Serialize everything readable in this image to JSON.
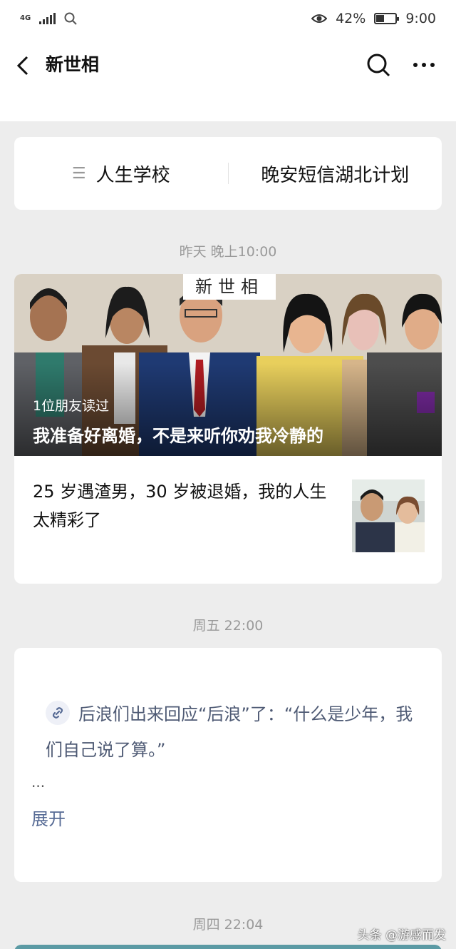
{
  "status_bar": {
    "network": "4G",
    "battery_percent": "42%",
    "battery_level": 0.42,
    "time": "9:00",
    "icons": [
      "signal-icon",
      "search-icon",
      "eye-icon",
      "battery-icon"
    ]
  },
  "nav": {
    "title": "新世相",
    "icons": [
      "back-icon",
      "search-icon",
      "more-icon"
    ]
  },
  "menu": {
    "items": [
      {
        "label": "人生学校",
        "icon": "menu-icon"
      },
      {
        "label": "晚安短信湖北计划"
      }
    ]
  },
  "timestamps": {
    "first": "昨天 晚上10:00",
    "second": "周五 22:00",
    "third": "周四 22:04"
  },
  "article": {
    "brand_tag": "新世相",
    "readers": "1位朋友读过",
    "headline": "我准备好离婚，不是来听你劝我冷静的",
    "sub_title": "25 岁遇渣男，30 岁被退婚，我的人生太精彩了"
  },
  "text_message": {
    "text": "后浪们出来回应“后浪”了：“什么是少年，我们自己说了算。”",
    "ellipsis": "...",
    "expand": "展开",
    "icon": "link-icon"
  },
  "watermark": "头条 @游感而发",
  "colors": {
    "background": "#ededed",
    "card": "#ffffff",
    "link": "#576b95",
    "muted": "#9a9a9a"
  }
}
